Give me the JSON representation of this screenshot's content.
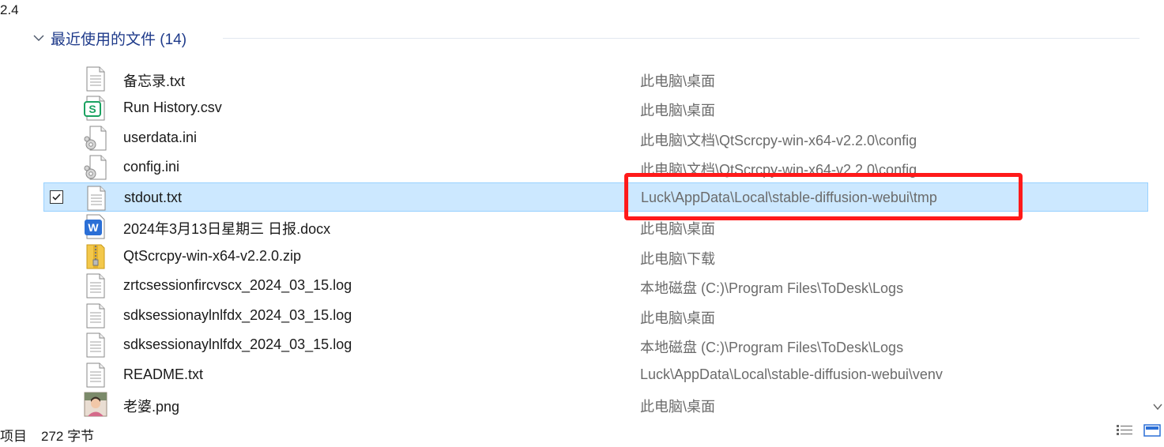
{
  "top": {
    "version_text": "2.4"
  },
  "group": {
    "title": "最近使用的文件 (14)"
  },
  "files": [
    {
      "name": "备忘录.txt",
      "path": "此电脑\\桌面",
      "icon": "text-file-icon"
    },
    {
      "name": "Run History.csv",
      "path": "此电脑\\桌面",
      "icon": "spreadsheet-file-icon"
    },
    {
      "name": "userdata.ini",
      "path": "此电脑\\文档\\QtScrcpy-win-x64-v2.2.0\\config",
      "icon": "settings-file-icon"
    },
    {
      "name": "config.ini",
      "path": "此电脑\\文档\\QtScrcpy-win-x64-v2.2.0\\config",
      "icon": "settings-file-icon"
    },
    {
      "name": "stdout.txt",
      "path": "Luck\\AppData\\Local\\stable-diffusion-webui\\tmp",
      "icon": "text-file-icon",
      "selected": true
    },
    {
      "name": "2024年3月13日星期三 日报.docx",
      "path": "此电脑\\桌面",
      "icon": "word-file-icon"
    },
    {
      "name": "QtScrcpy-win-x64-v2.2.0.zip",
      "path": "此电脑\\下载",
      "icon": "zip-file-icon"
    },
    {
      "name": "zrtcsessionfircvscx_2024_03_15.log",
      "path": "本地磁盘 (C:)\\Program Files\\ToDesk\\Logs",
      "icon": "text-file-icon"
    },
    {
      "name": "sdksessionaylnlfdx_2024_03_15.log",
      "path": "此电脑\\桌面",
      "icon": "text-file-icon"
    },
    {
      "name": "sdksessionaylnlfdx_2024_03_15.log",
      "path": "本地磁盘 (C:)\\Program Files\\ToDesk\\Logs",
      "icon": "text-file-icon"
    },
    {
      "name": "README.txt",
      "path": "Luck\\AppData\\Local\\stable-diffusion-webui\\venv",
      "icon": "text-file-icon"
    },
    {
      "name": "老婆.png",
      "path": "此电脑\\桌面",
      "icon": "image-file-icon"
    }
  ],
  "status": {
    "items_text": "项目",
    "size_text": "272 字节"
  },
  "colors": {
    "selected_bg": "#cce8ff",
    "selected_border": "#99d1ff",
    "highlight": "#ff1a1a",
    "group_header": "#1e3a8a"
  }
}
